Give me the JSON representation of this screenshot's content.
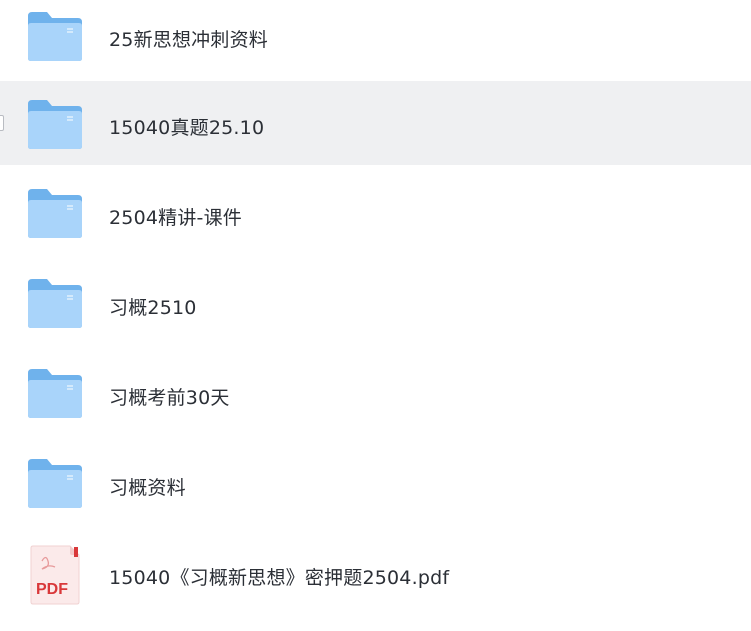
{
  "files": [
    {
      "name": "25新思想冲刺资料",
      "type": "folder-icon"
    },
    {
      "name": "15040真题25.10",
      "type": "folder-icon"
    },
    {
      "name": "2504精讲-课件",
      "type": "folder-icon"
    },
    {
      "name": "习概2510",
      "type": "folder-icon"
    },
    {
      "name": "习概考前30天",
      "type": "folder-icon"
    },
    {
      "name": "习概资料",
      "type": "folder-icon"
    },
    {
      "name": "15040《习概新思想》密押题2504.pdf",
      "type": "pdf-file-icon",
      "badge": "PDF"
    }
  ],
  "colors": {
    "folder_back": "#6fb2ec",
    "folder_front": "#a9d4fa",
    "hover_row": "#eff0f2",
    "pdf_red": "#d9383a"
  }
}
